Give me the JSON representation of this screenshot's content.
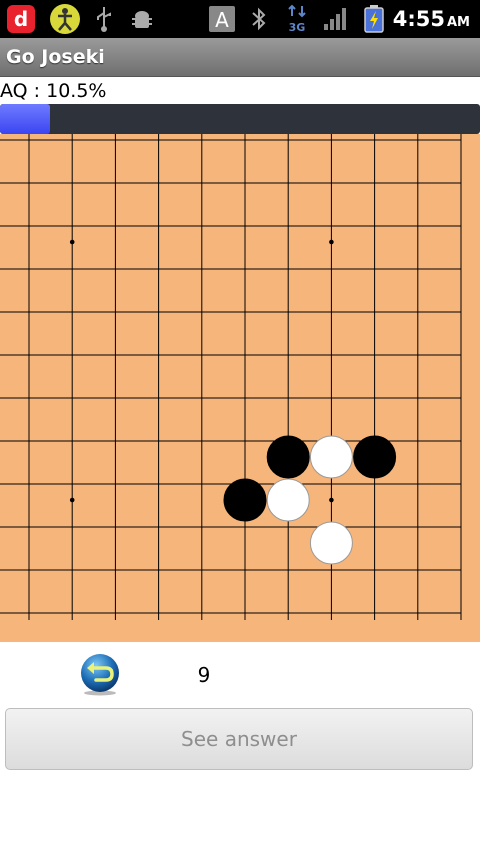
{
  "status_bar": {
    "time": "4:55",
    "ampm": "AM",
    "icons": [
      "d-app-icon",
      "joseki-app-icon",
      "usb-icon",
      "android-debug-icon",
      "a-keyboard-icon",
      "bluetooth-icon",
      "3g-data-icon",
      "signal-icon",
      "battery-charging-icon"
    ]
  },
  "app": {
    "title": "Go Joseki"
  },
  "quiz": {
    "aq_label": "AQ : 10.5%",
    "progress_fraction": 0.105,
    "move_number": "9",
    "see_answer_label": "See answer"
  },
  "board": {
    "background": "#f6b57a",
    "line_color": "#000000",
    "star_points": [
      [
        1,
        2
      ],
      [
        7,
        2
      ],
      [
        1,
        8
      ],
      [
        7,
        8
      ]
    ],
    "stones": [
      {
        "color": "black",
        "col": 6,
        "row": 7
      },
      {
        "color": "white",
        "col": 7,
        "row": 7
      },
      {
        "color": "black",
        "col": 8,
        "row": 7
      },
      {
        "color": "black",
        "col": 5,
        "row": 8
      },
      {
        "color": "white",
        "col": 6,
        "row": 8
      },
      {
        "color": "white",
        "col": 7,
        "row": 9
      }
    ]
  }
}
